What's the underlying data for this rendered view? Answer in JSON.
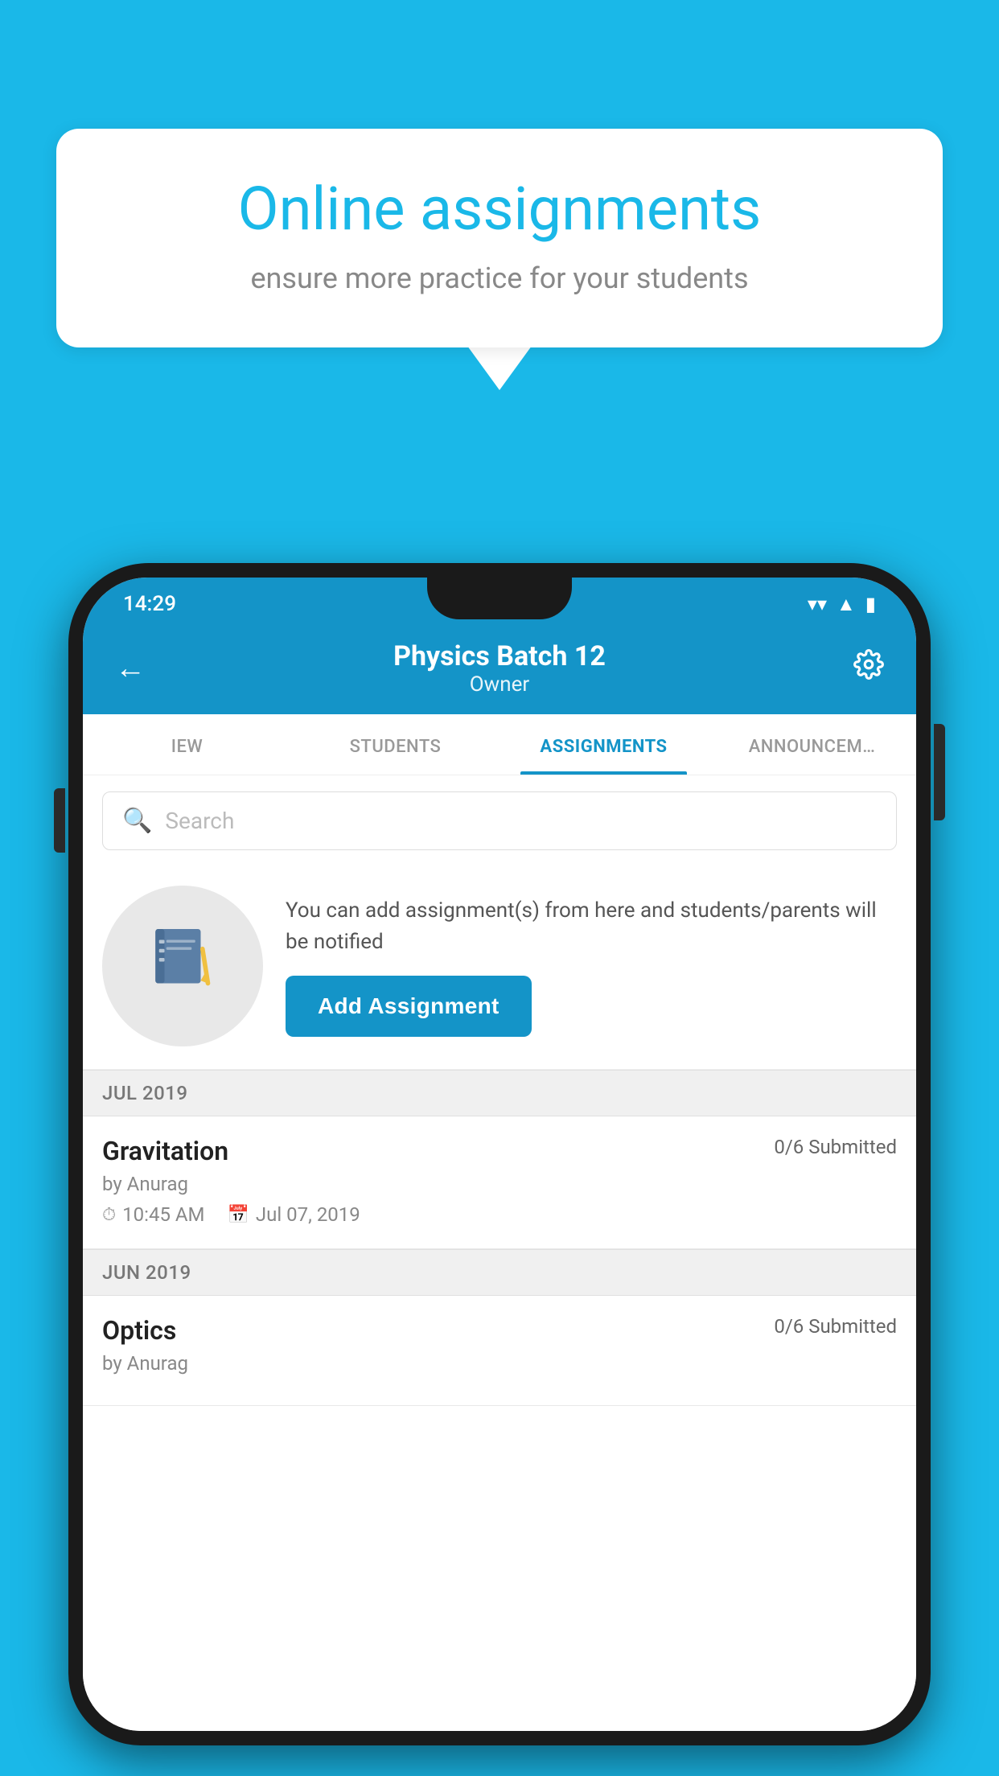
{
  "background": {
    "color": "#1ab8e8"
  },
  "speech_bubble": {
    "title": "Online assignments",
    "subtitle": "ensure more practice for your students"
  },
  "phone": {
    "status_bar": {
      "time": "14:29",
      "icons": [
        "wifi",
        "signal",
        "battery"
      ]
    },
    "header": {
      "title": "Physics Batch 12",
      "subtitle": "Owner",
      "back_label": "←",
      "settings_label": "⚙"
    },
    "tabs": [
      {
        "label": "IEW",
        "active": false
      },
      {
        "label": "STUDENTS",
        "active": false
      },
      {
        "label": "ASSIGNMENTS",
        "active": true
      },
      {
        "label": "ANNOUNCEM…",
        "active": false
      }
    ],
    "search": {
      "placeholder": "Search"
    },
    "promo": {
      "text": "You can add assignment(s) from here and students/parents will be notified",
      "button_label": "Add Assignment"
    },
    "sections": [
      {
        "month": "JUL 2019",
        "assignments": [
          {
            "title": "Gravitation",
            "submitted": "0/6 Submitted",
            "by": "by Anurag",
            "time": "10:45 AM",
            "date": "Jul 07, 2019"
          }
        ]
      },
      {
        "month": "JUN 2019",
        "assignments": [
          {
            "title": "Optics",
            "submitted": "0/6 Submitted",
            "by": "by Anurag",
            "time": "",
            "date": ""
          }
        ]
      }
    ]
  }
}
